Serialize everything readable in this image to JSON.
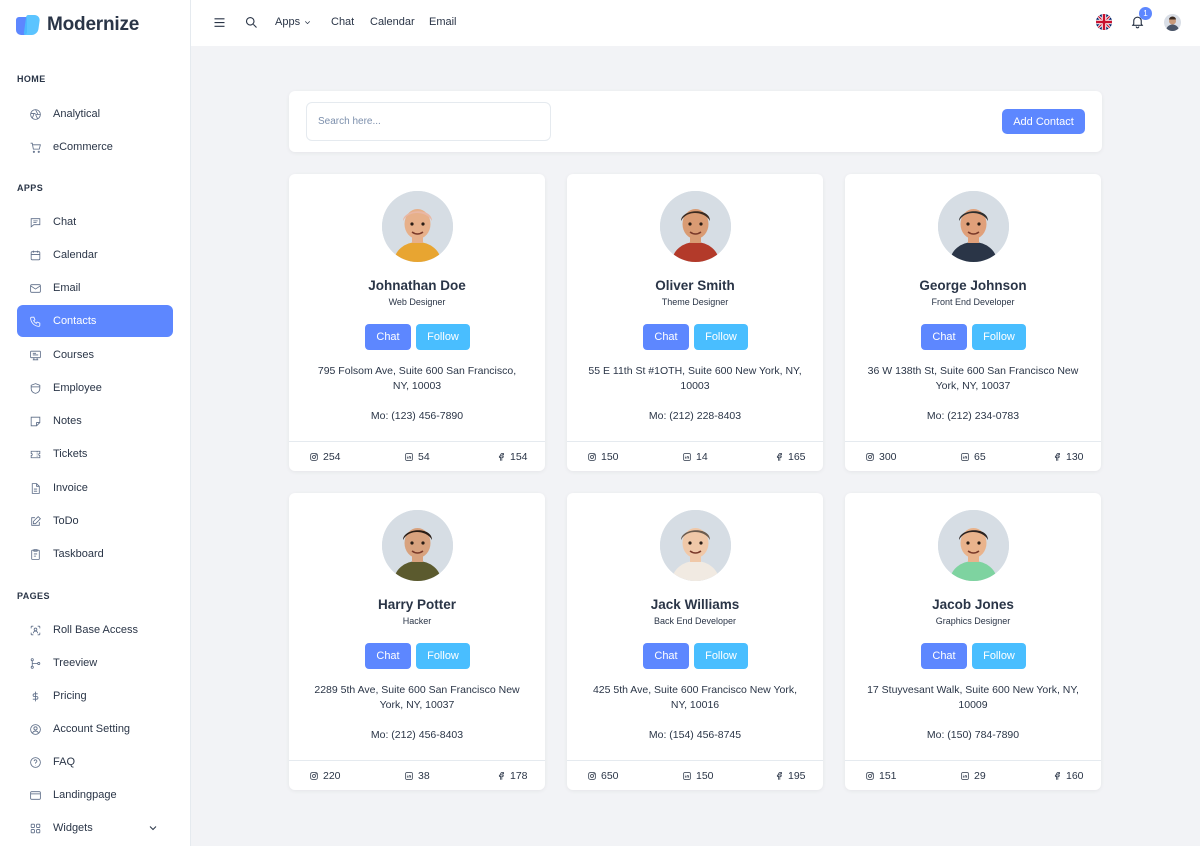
{
  "brand": {
    "name": "Modernize"
  },
  "sidebar": {
    "sections": [
      {
        "title": "HOME",
        "items": [
          {
            "label": "Analytical",
            "icon": "aperture-icon"
          },
          {
            "label": "eCommerce",
            "icon": "shopping-cart-icon"
          }
        ]
      },
      {
        "title": "APPS",
        "items": [
          {
            "label": "Chat",
            "icon": "message-icon"
          },
          {
            "label": "Calendar",
            "icon": "calendar-icon"
          },
          {
            "label": "Email",
            "icon": "mail-icon"
          },
          {
            "label": "Contacts",
            "icon": "phone-icon",
            "active": true
          },
          {
            "label": "Courses",
            "icon": "courses-icon"
          },
          {
            "label": "Employee",
            "icon": "shield-icon"
          },
          {
            "label": "Notes",
            "icon": "note-icon"
          },
          {
            "label": "Tickets",
            "icon": "ticket-icon"
          },
          {
            "label": "Invoice",
            "icon": "file-text-icon"
          },
          {
            "label": "ToDo",
            "icon": "edit-icon"
          },
          {
            "label": "Taskboard",
            "icon": "clipboard-icon"
          }
        ]
      },
      {
        "title": "PAGES",
        "items": [
          {
            "label": "Roll Base Access",
            "icon": "scan-user-icon"
          },
          {
            "label": "Treeview",
            "icon": "git-branch-icon"
          },
          {
            "label": "Pricing",
            "icon": "dollar-icon"
          },
          {
            "label": "Account Setting",
            "icon": "user-circle-icon"
          },
          {
            "label": "FAQ",
            "icon": "help-icon"
          },
          {
            "label": "Landingpage",
            "icon": "app-window-icon"
          },
          {
            "label": "Widgets",
            "icon": "layout-icon",
            "expandable": true
          }
        ]
      }
    ]
  },
  "topbar": {
    "links": {
      "apps": "Apps",
      "chat": "Chat",
      "calendar": "Calendar",
      "email": "Email"
    },
    "notification_count": "1",
    "language": "en-GB",
    "colors": {
      "accent": "#5d87ff",
      "secondary": "#49beff"
    }
  },
  "search": {
    "placeholder": "Search here...",
    "add_label": "Add Contact"
  },
  "contacts": [
    {
      "name": "Johnathan Doe",
      "role": "Web Designer",
      "address": "795 Folsom Ave, Suite 600 San Francisco, NY, 10003",
      "phone": "Mo: (123) 456-7890",
      "instagram": "254",
      "linkedin": "54",
      "facebook": "154",
      "chat_label": "Chat",
      "follow_label": "Follow"
    },
    {
      "name": "Oliver Smith",
      "role": "Theme Designer",
      "address": "55 E 11th St #1OTH, Suite 600 New York, NY, 10003",
      "phone": "Mo: (212) 228-8403",
      "instagram": "150",
      "linkedin": "14",
      "facebook": "165",
      "chat_label": "Chat",
      "follow_label": "Follow"
    },
    {
      "name": "George Johnson",
      "role": "Front End Developer",
      "address": "36 W 138th St, Suite 600 San Francisco New York, NY, 10037",
      "phone": "Mo: (212) 234-0783",
      "instagram": "300",
      "linkedin": "65",
      "facebook": "130",
      "chat_label": "Chat",
      "follow_label": "Follow"
    },
    {
      "name": "Harry Potter",
      "role": "Hacker",
      "address": "2289 5th Ave, Suite 600 San Francisco New York, NY, 10037",
      "phone": "Mo: (212) 456-8403",
      "instagram": "220",
      "linkedin": "38",
      "facebook": "178",
      "chat_label": "Chat",
      "follow_label": "Follow"
    },
    {
      "name": "Jack Williams",
      "role": "Back End Developer",
      "address": "425 5th Ave, Suite 600 Francisco New York, NY, 10016",
      "phone": "Mo: (154) 456-8745",
      "instagram": "650",
      "linkedin": "150",
      "facebook": "195",
      "chat_label": "Chat",
      "follow_label": "Follow"
    },
    {
      "name": "Jacob Jones",
      "role": "Graphics Designer",
      "address": "17 Stuyvesant Walk, Suite 600 New York, NY, 10009",
      "phone": "Mo: (150) 784-7890",
      "instagram": "151",
      "linkedin": "29",
      "facebook": "160",
      "chat_label": "Chat",
      "follow_label": "Follow"
    }
  ]
}
